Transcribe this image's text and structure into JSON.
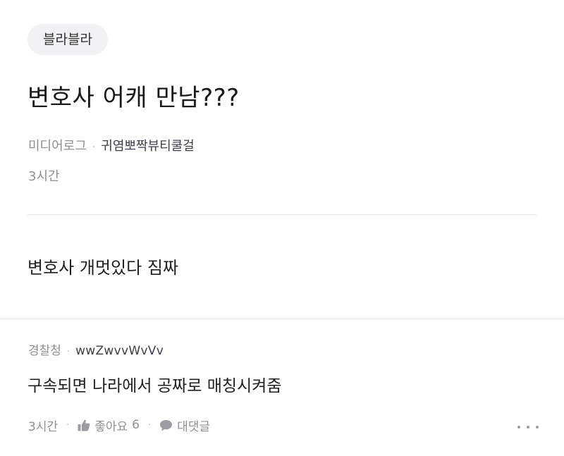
{
  "post": {
    "category": "블라블라",
    "title": "변호사 어캐 만남???",
    "company": "미디어로그",
    "meta_separator": "·",
    "author": "귀염뽀짝뷰티쿨걸",
    "time": "3시간",
    "body": "변호사 개멋있다 짐짜"
  },
  "comment": {
    "company": "경찰청",
    "meta_separator": "·",
    "author": "wwZwvvWvVv",
    "text": "구속되면 나라에서 공짜로 매칭시켜줌",
    "time": "3시간",
    "action_separator": "·",
    "like_label": "좋아요",
    "like_count": "6",
    "reply_label": "대댓글",
    "icons": {
      "like": "thumbs-up-icon",
      "reply": "speech-bubble-icon",
      "more": "more-dots-icon"
    }
  },
  "colors": {
    "chip_bg": "#f1f2f4",
    "muted_text": "#8d9096",
    "primary_text": "#1f1f1f",
    "divider": "#e5e6e8"
  }
}
